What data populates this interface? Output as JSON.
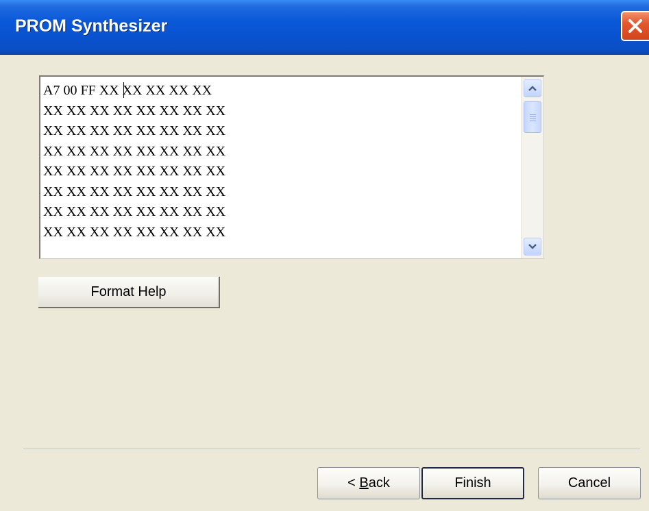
{
  "window": {
    "title": "PROM Synthesizer"
  },
  "editor": {
    "content": "A7 00 FF XX XX XX XX XX\nXX XX XX XX XX XX XX XX\nXX XX XX XX XX XX XX XX\nXX XX XX XX XX XX XX XX\nXX XX XX XX XX XX XX XX\nXX XX XX XX XX XX XX XX\nXX XX XX XX XX XX XX XX\nXX XX XX XX XX XX XX XX"
  },
  "buttons": {
    "format_help": "Format Help",
    "back_prefix": "< ",
    "back_mnemonic": "B",
    "back_rest": "ack",
    "finish": "Finish",
    "cancel": "Cancel"
  },
  "icons": {
    "close": "close-icon",
    "scroll_up": "scroll-up-arrow-icon",
    "scroll_down": "scroll-down-arrow-icon"
  },
  "colors": {
    "titlebar": "#0a58d8",
    "dialog_bg": "#ece9d8",
    "close_button": "#e2582f"
  }
}
